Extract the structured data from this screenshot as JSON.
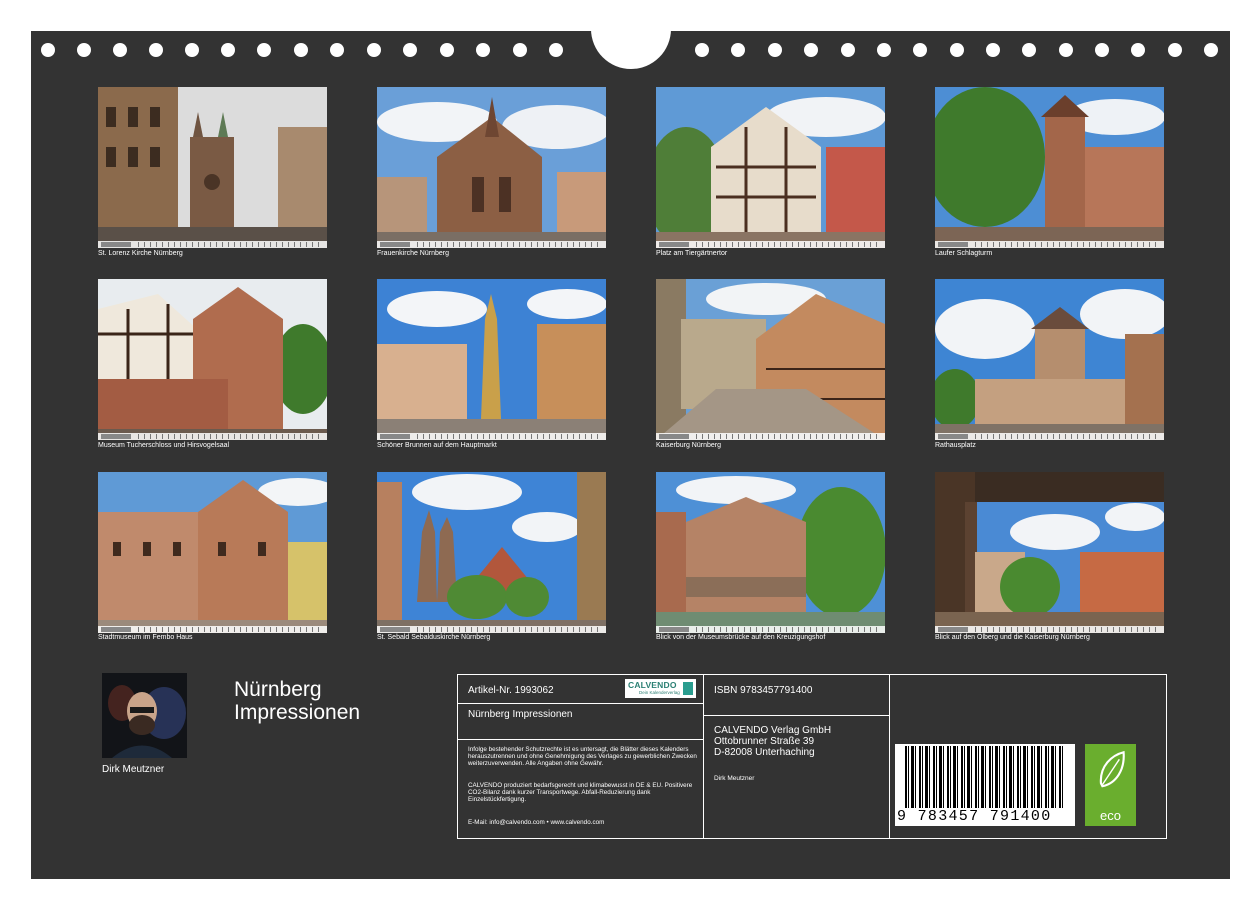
{
  "calendar": {
    "title_line1": "Nürnberg",
    "title_line2": "Impressionen",
    "author": "Dirk Meutzner"
  },
  "photos": [
    {
      "caption": "St. Lorenz Kirche Nürnberg"
    },
    {
      "caption": "Frauenkirche Nürnberg"
    },
    {
      "caption": "Platz am Tiergärtnertor"
    },
    {
      "caption": "Laufer Schlagturm"
    },
    {
      "caption": "Museum Tucherschloss und Hirsvogelsaal"
    },
    {
      "caption": "Schöner Brunnen auf dem Hauptmarkt"
    },
    {
      "caption": "Kaiserburg Nürnberg"
    },
    {
      "caption": "Rathausplatz"
    },
    {
      "caption": "Stadtmuseum im Fembo Haus"
    },
    {
      "caption": "St. Sebald Sebalduskirche Nürnberg"
    },
    {
      "caption": "Blick von der Museumsbrücke auf den Kreuzigungshof"
    },
    {
      "caption": "Blick auf den Ölberg und die Kaiserburg Nürnberg"
    }
  ],
  "info": {
    "article": "Artikel-Nr. 1993062",
    "product_title": "Nürnberg Impressionen",
    "brand_name": "CALVENDO",
    "brand_sub": "Dein Kalenderverlag",
    "legal": "Infolge bestehender Schutzrechte ist es untersagt, die Blätter dieses Kalenders herauszutrennen und ohne Genehmigung des Verlages zu gewerblichen Zwecken weiterzuverwenden. Alle Angaben ohne Gewähr.",
    "climate": "CALVENDO produziert bedarfsgerecht und klimabewusst in DE & EU. Positivere CO2-Bilanz dank kurzer Transportwege. Abfall-Reduzierung dank Einzelstückfertigung.",
    "contact": "E-Mail: info@calvendo.com • www.calvendo.com",
    "isbn": "ISBN 9783457791400",
    "publisher_name": "CALVENDO Verlag GmbH",
    "publisher_street": "Ottobrunner Straße 39",
    "publisher_city": "D-82008 Unterhaching",
    "author": "Dirk Meutzner",
    "barcode_number": "9 783457 791400",
    "eco_label": "eco"
  },
  "colors": {
    "background": "#333333",
    "text": "#ffffff",
    "eco_green": "#6aae2e",
    "brand_teal": "#2a7f73"
  }
}
